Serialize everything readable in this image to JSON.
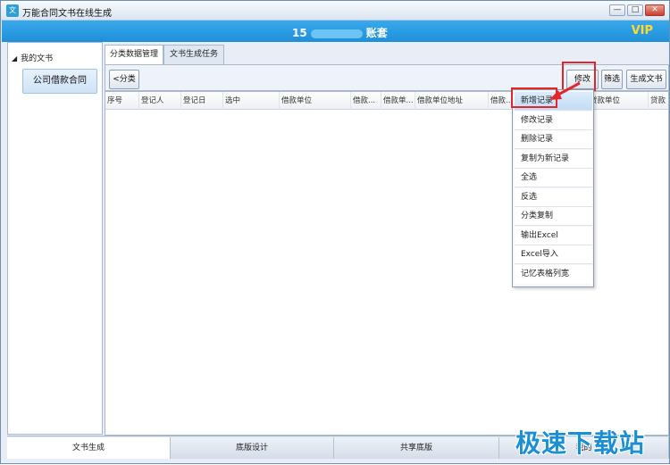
{
  "window": {
    "icon_text": "文",
    "title": "万能合同文书在线生成",
    "min": "—",
    "max": "□",
    "close": "✕"
  },
  "header": {
    "account_prefix": "15",
    "account_suffix": "账套",
    "vip": "VIP"
  },
  "tree": {
    "root_arrow": "◢",
    "root": "我的文书",
    "items": [
      {
        "label": "公司借款合同"
      }
    ]
  },
  "tabs": [
    {
      "label": "分类数据管理",
      "active": true
    },
    {
      "label": "文书生成任务",
      "active": false
    }
  ],
  "toolbar": {
    "category": "<分类",
    "modify": "修改",
    "filter": "筛选",
    "generate": "生成文书"
  },
  "table": {
    "columns": [
      "序号",
      "登记人",
      "登记日",
      "选中",
      "借款单位",
      "借款...",
      "借款单...",
      "借款单位地址",
      "借款...",
      "贷款单位",
      "贷款"
    ]
  },
  "menu": {
    "items": [
      "新增记录",
      "修改记录",
      "删除记录",
      "复制为新记录",
      "全选",
      "反选",
      "分类复制",
      "输出Excel",
      "Excel导入",
      "记忆表格列宽"
    ]
  },
  "bottom_tabs": [
    {
      "label": "文书生成",
      "active": true
    },
    {
      "label": "底版设计",
      "active": false
    },
    {
      "label": "共享底版",
      "active": false
    },
    {
      "label": "我的",
      "active": false
    }
  ],
  "watermark": "极速下载站",
  "colors": {
    "header_blue": "#1f8fd8",
    "vip_gold": "#ffd92e",
    "highlight_red": "#e3262b"
  }
}
